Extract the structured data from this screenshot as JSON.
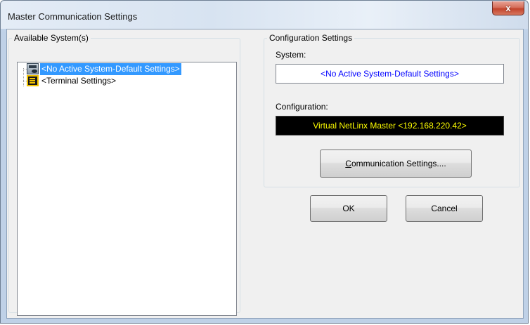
{
  "window": {
    "title": "Master Communication Settings",
    "close_glyph": "x"
  },
  "available_systems": {
    "legend": "Available System(s)",
    "items": [
      {
        "label": "<No Active System-Default Settings>",
        "icon": "system-icon",
        "selected": true
      },
      {
        "label": "<Terminal Settings>",
        "icon": "terminal-icon",
        "selected": false
      }
    ]
  },
  "configuration_settings": {
    "legend": "Configuration Settings",
    "system_label": "System:",
    "system_value": "<No Active System-Default Settings>",
    "configuration_label": "Configuration:",
    "configuration_value": "Virtual NetLinx Master <192.168.220.42>",
    "communication_button": {
      "mnemonic": "C",
      "rest": "ommunication Settings...."
    }
  },
  "buttons": {
    "ok": "OK",
    "cancel": "Cancel"
  },
  "colors": {
    "selection": "#3399ff",
    "system_text": "#0000ff",
    "config_text": "#ffff00",
    "config_bg": "#000000",
    "close_button": "#c2442c"
  }
}
